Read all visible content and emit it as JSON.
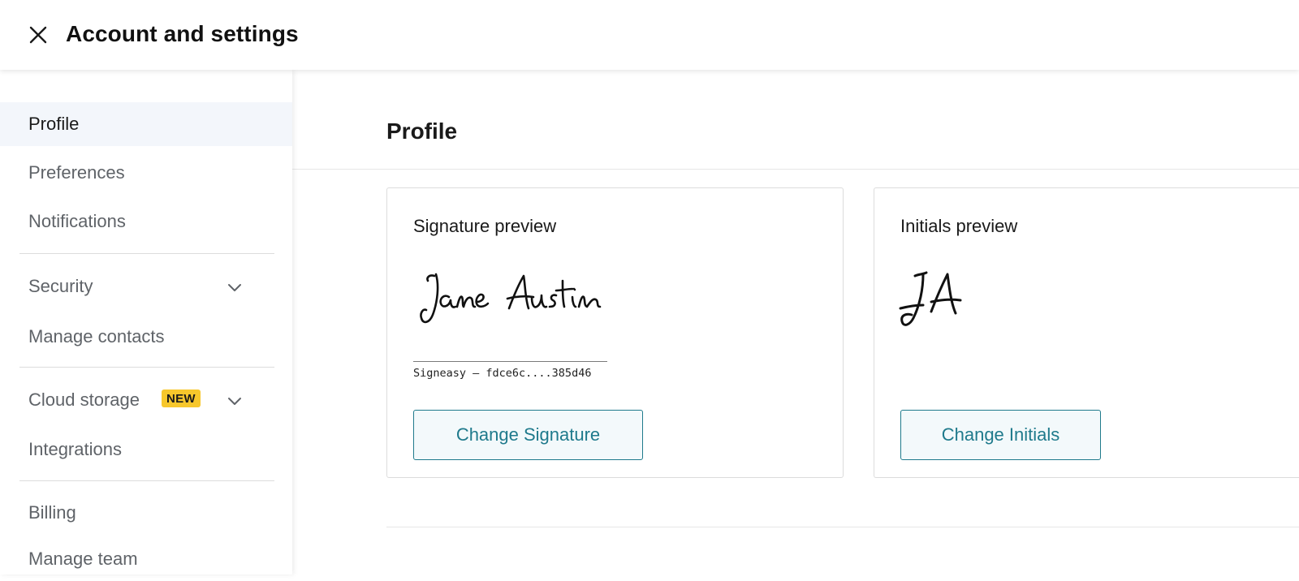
{
  "header": {
    "title": "Account and settings",
    "close_icon": "close-icon"
  },
  "sidebar": {
    "items": [
      {
        "label": "Profile",
        "active": true
      },
      {
        "label": "Preferences"
      },
      {
        "label": "Notifications"
      },
      {
        "label": "Security",
        "icon": "chevron-down-icon"
      },
      {
        "label": "Manage contacts"
      },
      {
        "label": "Cloud storage",
        "badge": "NEW",
        "icon": "chevron-down-icon"
      },
      {
        "label": "Integrations"
      },
      {
        "label": "Billing"
      },
      {
        "label": "Manage team"
      }
    ]
  },
  "main": {
    "title": "Profile",
    "signature_card": {
      "title": "Signature preview",
      "signature_id": "Signeasy — fdce6c....385d46",
      "button_label": "Change Signature"
    },
    "initials_card": {
      "title": "Initials preview",
      "button_label": "Change Initials"
    }
  },
  "colors": {
    "accent": "#1f7a8c",
    "badge": "#f7c72c",
    "active_bg": "#f3f6fb",
    "muted_text": "#5f6368"
  }
}
